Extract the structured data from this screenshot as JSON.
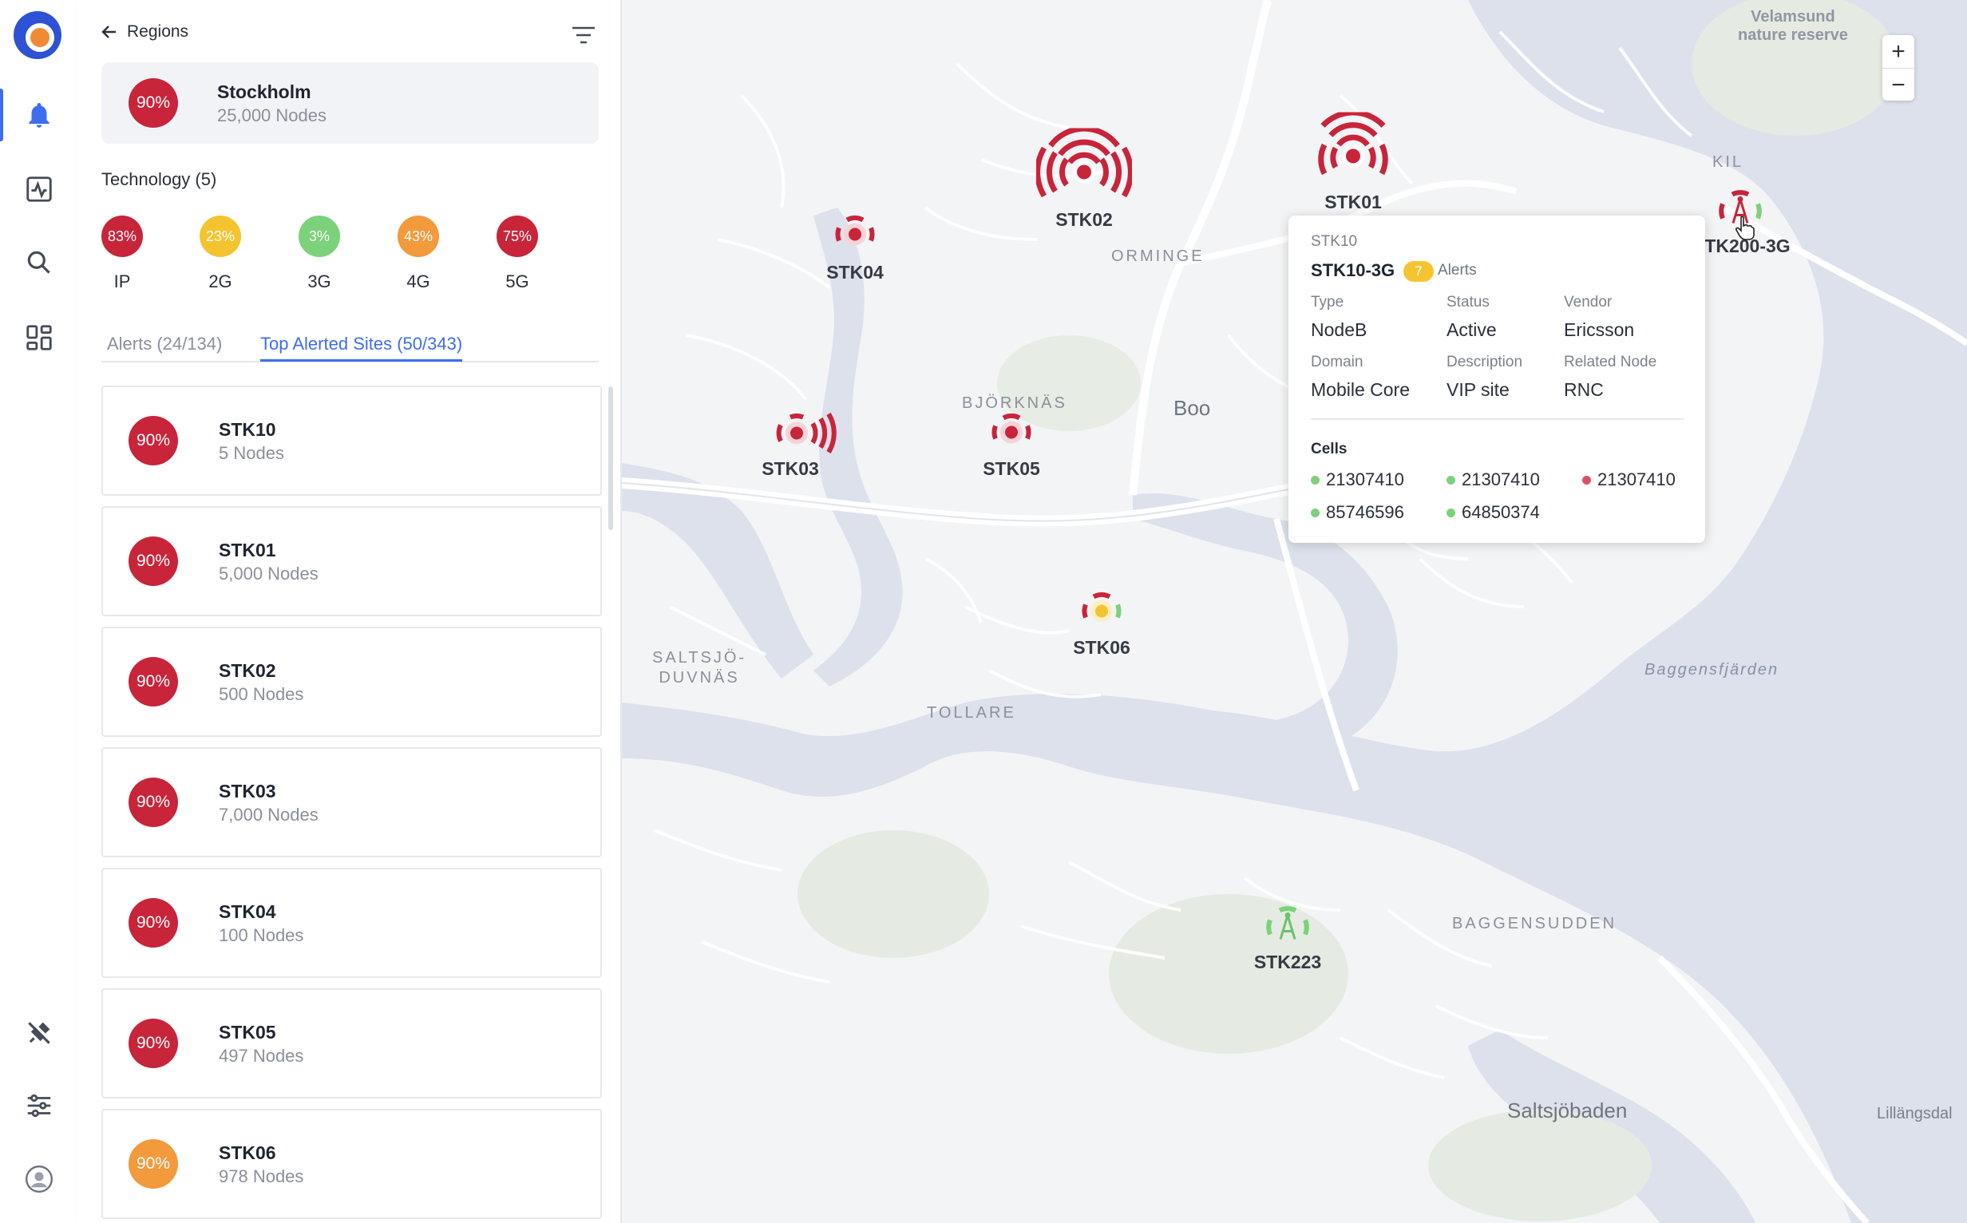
{
  "rail": {
    "icons": [
      "alerts-bell-icon",
      "activity-chart-icon",
      "search-icon",
      "dashboard-grid-icon",
      "plug-disconnect-icon",
      "settings-sliders-icon",
      "user-avatar-icon"
    ]
  },
  "panel": {
    "back_label": "Regions",
    "region": {
      "percent": "90%",
      "name": "Stockholm",
      "nodes": "25,000 Nodes"
    },
    "technology_title": "Technology (5)",
    "technologies": [
      {
        "percent": "83%",
        "label": "IP",
        "color": "#c8243a"
      },
      {
        "percent": "23%",
        "label": "2G",
        "color": "#f4c430"
      },
      {
        "percent": "3%",
        "label": "3G",
        "color": "#7bd27a"
      },
      {
        "percent": "43%",
        "label": "4G",
        "color": "#f29a3c"
      },
      {
        "percent": "75%",
        "label": "5G",
        "color": "#c8243a"
      }
    ],
    "tabs": [
      {
        "label": "Alerts (24/134)"
      },
      {
        "label": "Top Alerted Sites (50/343)"
      }
    ],
    "sites": [
      {
        "percent": "90%",
        "name": "STK10",
        "nodes": "5 Nodes",
        "color": "#c8243a"
      },
      {
        "percent": "90%",
        "name": "STK01",
        "nodes": "5,000 Nodes",
        "color": "#c8243a"
      },
      {
        "percent": "90%",
        "name": "STK02",
        "nodes": "500 Nodes",
        "color": "#c8243a"
      },
      {
        "percent": "90%",
        "name": "STK03",
        "nodes": "7,000 Nodes",
        "color": "#c8243a"
      },
      {
        "percent": "90%",
        "name": "STK04",
        "nodes": "100 Nodes",
        "color": "#c8243a"
      },
      {
        "percent": "90%",
        "name": "STK05",
        "nodes": "497 Nodes",
        "color": "#c8243a"
      },
      {
        "percent": "90%",
        "name": "STK06",
        "nodes": "978 Nodes",
        "color": "#f29a3c"
      }
    ]
  },
  "map": {
    "places": {
      "velamsund": "Velamsund\nnature reserve",
      "kil": "KIL",
      "orminge": "ORMINGE",
      "bjorknas": "BJÖRKNÄS",
      "boo": "Boo",
      "saltsjo": "SALTSJÖ-\nDUVNÄS",
      "tollare": "TOLLARE",
      "baggensfjarden": "Baggensfjärden",
      "baggensudden": "BAGGENSUDDEN",
      "saltsjobaden": "Saltsjöbaden",
      "lillangsdal": "Lillängsdal"
    },
    "markers": {
      "stk01": "STK01",
      "stk02": "STK02",
      "stk03": "STK03",
      "stk04": "STK04",
      "stk05": "STK05",
      "stk06": "STK06",
      "stk200": "TK200-3G",
      "stk223": "STK223"
    },
    "zoom": {
      "in": "+",
      "out": "−"
    }
  },
  "popup": {
    "site_id": "STK10",
    "name": "STK10-3G",
    "alert_count": "7",
    "alerts_label": "Alerts",
    "fields": {
      "type_label": "Type",
      "type": "NodeB",
      "status_label": "Status",
      "status": "Active",
      "vendor_label": "Vendor",
      "vendor": "Ericsson",
      "domain_label": "Domain",
      "domain": "Mobile Core",
      "description_label": "Description",
      "description": "VIP site",
      "related_label": "Related Node",
      "related": "RNC"
    },
    "cells_title": "Cells",
    "cells": [
      {
        "id": "21307410",
        "status_color": "#7bd27a"
      },
      {
        "id": "21307410",
        "status_color": "#7bd27a"
      },
      {
        "id": "21307410",
        "status_color": "#d9506a"
      },
      {
        "id": "85746596",
        "status_color": "#7bd27a"
      },
      {
        "id": "64850374",
        "status_color": "#7bd27a"
      }
    ]
  }
}
